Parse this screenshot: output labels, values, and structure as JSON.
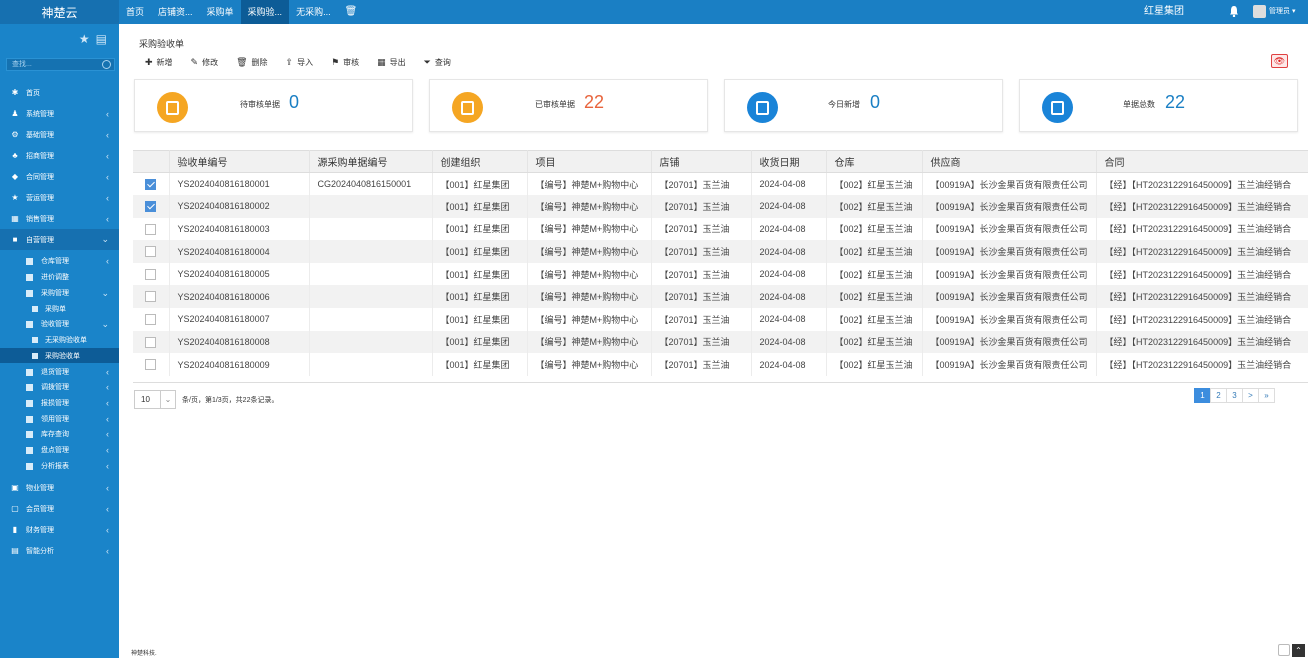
{
  "brand": "神楚云",
  "topnav": [
    "首页",
    "店铺资...",
    "采购单",
    "采购验...",
    "无采购...",
    "🗑"
  ],
  "org": "红星集团",
  "user": "管理员",
  "sidebar": {
    "search_placeholder": "查找...",
    "items": [
      {
        "icon": "✱",
        "label": "首页"
      },
      {
        "icon": "♟",
        "label": "系统管理"
      },
      {
        "icon": "⚙",
        "label": "基础管理"
      },
      {
        "icon": "♣",
        "label": "招商管理"
      },
      {
        "icon": "◆",
        "label": "合同管理"
      },
      {
        "icon": "★",
        "label": "营运管理"
      },
      {
        "icon": "▦",
        "label": "销售管理"
      },
      {
        "icon": "■",
        "label": "自营管理"
      }
    ],
    "sub": [
      "仓库管理",
      "进价调整",
      "采购管理",
      "采购单",
      "验收管理",
      "无采购验收单",
      "采购验收单",
      "退货管理",
      "调拨管理",
      "报损管理",
      "领用管理",
      "库存查询",
      "盘点管理",
      "分析报表"
    ],
    "items2": [
      {
        "icon": "▣",
        "label": "物业管理"
      },
      {
        "icon": "▢",
        "label": "会员管理"
      },
      {
        "icon": "▮",
        "label": "财务管理"
      },
      {
        "icon": "▤",
        "label": "智能分析"
      }
    ]
  },
  "page": {
    "title": "采购验收单",
    "toolbar": [
      {
        "glyph": "✚",
        "label": "新增"
      },
      {
        "glyph": "✎",
        "label": "修改"
      },
      {
        "glyph": "🗑",
        "label": "删除"
      },
      {
        "glyph": "⇪",
        "label": "导入"
      },
      {
        "glyph": "⚑",
        "label": "审核"
      },
      {
        "glyph": "▦",
        "label": "导出"
      },
      {
        "glyph": "⏷",
        "label": "查询"
      }
    ]
  },
  "cards": [
    {
      "label": "待审核单据",
      "value": "0",
      "color": "#f5a623",
      "value_color": "#1a7fc4"
    },
    {
      "label": "已审核单据",
      "value": "22",
      "color": "#f5a623",
      "value_color": "#e8643c"
    },
    {
      "label": "今日新增",
      "value": "0",
      "color": "#1a84d8",
      "value_color": "#1a7fc4"
    },
    {
      "label": "单据总数",
      "value": "22",
      "color": "#1a84d8",
      "value_color": "#1a7fc4"
    }
  ],
  "table": {
    "columns": [
      "验收单编号",
      "源采购单据编号",
      "创建组织",
      "项目",
      "店铺",
      "收货日期",
      "仓库",
      "供应商",
      "合同"
    ],
    "rows": [
      {
        "checked": true,
        "cells": [
          "YS2024040816180001",
          "CG2024040816150001",
          "【001】红星集团",
          "【编号】神楚M+购物中心",
          "【20701】玉兰油",
          "2024-04-08",
          "【002】红星玉兰油",
          "【00919A】长沙金果百货有限责任公司",
          "【经】【HT2023122916450009】玉兰油经销合"
        ]
      },
      {
        "checked": true,
        "cells": [
          "YS2024040816180002",
          "",
          "【001】红星集团",
          "【编号】神楚M+购物中心",
          "【20701】玉兰油",
          "2024-04-08",
          "【002】红星玉兰油",
          "【00919A】长沙金果百货有限责任公司",
          "【经】【HT2023122916450009】玉兰油经销合"
        ]
      },
      {
        "checked": false,
        "cells": [
          "YS2024040816180003",
          "",
          "【001】红星集团",
          "【编号】神楚M+购物中心",
          "【20701】玉兰油",
          "2024-04-08",
          "【002】红星玉兰油",
          "【00919A】长沙金果百货有限责任公司",
          "【经】【HT2023122916450009】玉兰油经销合"
        ]
      },
      {
        "checked": false,
        "cells": [
          "YS2024040816180004",
          "",
          "【001】红星集团",
          "【编号】神楚M+购物中心",
          "【20701】玉兰油",
          "2024-04-08",
          "【002】红星玉兰油",
          "【00919A】长沙金果百货有限责任公司",
          "【经】【HT2023122916450009】玉兰油经销合"
        ]
      },
      {
        "checked": false,
        "cells": [
          "YS2024040816180005",
          "",
          "【001】红星集团",
          "【编号】神楚M+购物中心",
          "【20701】玉兰油",
          "2024-04-08",
          "【002】红星玉兰油",
          "【00919A】长沙金果百货有限责任公司",
          "【经】【HT2023122916450009】玉兰油经销合"
        ]
      },
      {
        "checked": false,
        "cells": [
          "YS2024040816180006",
          "",
          "【001】红星集团",
          "【编号】神楚M+购物中心",
          "【20701】玉兰油",
          "2024-04-08",
          "【002】红星玉兰油",
          "【00919A】长沙金果百货有限责任公司",
          "【经】【HT2023122916450009】玉兰油经销合"
        ]
      },
      {
        "checked": false,
        "cells": [
          "YS2024040816180007",
          "",
          "【001】红星集团",
          "【编号】神楚M+购物中心",
          "【20701】玉兰油",
          "2024-04-08",
          "【002】红星玉兰油",
          "【00919A】长沙金果百货有限责任公司",
          "【经】【HT2023122916450009】玉兰油经销合"
        ]
      },
      {
        "checked": false,
        "cells": [
          "YS2024040816180008",
          "",
          "【001】红星集团",
          "【编号】神楚M+购物中心",
          "【20701】玉兰油",
          "2024-04-08",
          "【002】红星玉兰油",
          "【00919A】长沙金果百货有限责任公司",
          "【经】【HT2023122916450009】玉兰油经销合"
        ]
      },
      {
        "checked": false,
        "cells": [
          "YS2024040816180009",
          "",
          "【001】红星集团",
          "【编号】神楚M+购物中心",
          "【20701】玉兰油",
          "2024-04-08",
          "【002】红星玉兰油",
          "【00919A】长沙金果百货有限责任公司",
          "【经】【HT2023122916450009】玉兰油经销合"
        ]
      }
    ]
  },
  "pager": {
    "size": "10",
    "info": "条/页，第1/3页，共22条记录。",
    "pages": [
      "1",
      "2",
      "3",
      ">",
      "»"
    ]
  },
  "footer": "神楚科技."
}
